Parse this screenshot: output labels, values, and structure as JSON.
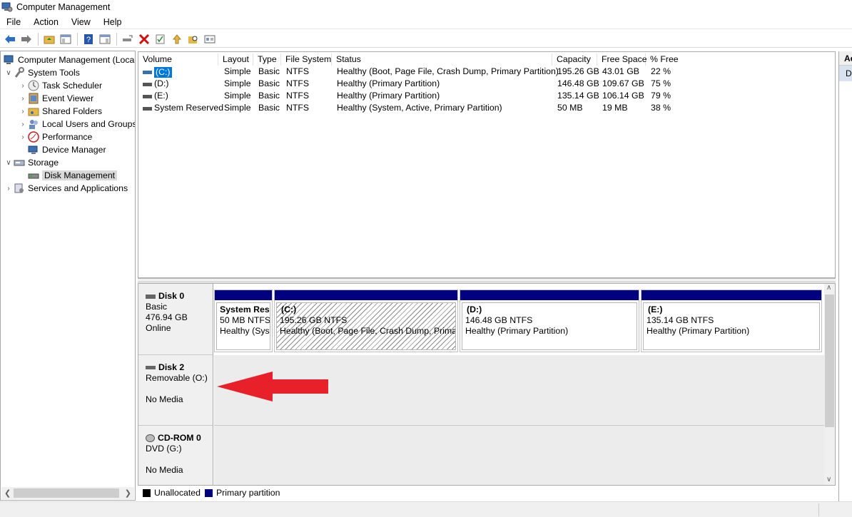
{
  "window": {
    "title": "Computer Management"
  },
  "menu": [
    "File",
    "Action",
    "View",
    "Help"
  ],
  "tree": {
    "root": "Computer Management (Local",
    "system_tools": "System Tools",
    "task_scheduler": "Task Scheduler",
    "event_viewer": "Event Viewer",
    "shared_folders": "Shared Folders",
    "local_users": "Local Users and Groups",
    "performance": "Performance",
    "device_manager": "Device Manager",
    "storage": "Storage",
    "disk_management": "Disk Management",
    "services": "Services and Applications"
  },
  "volumes": {
    "columns": [
      "Volume",
      "Layout",
      "Type",
      "File System",
      "Status",
      "Capacity",
      "Free Space",
      "% Free"
    ],
    "rows": [
      [
        "(C:)",
        "Simple",
        "Basic",
        "NTFS",
        "Healthy (Boot, Page File, Crash Dump, Primary Partition)",
        "195.26 GB",
        "43.01 GB",
        "22 %"
      ],
      [
        "(D:)",
        "Simple",
        "Basic",
        "NTFS",
        "Healthy (Primary Partition)",
        "146.48 GB",
        "109.67 GB",
        "75 %"
      ],
      [
        "(E:)",
        "Simple",
        "Basic",
        "NTFS",
        "Healthy (Primary Partition)",
        "135.14 GB",
        "106.14 GB",
        "79 %"
      ],
      [
        "System Reserved",
        "Simple",
        "Basic",
        "NTFS",
        "Healthy (System, Active, Primary Partition)",
        "50 MB",
        "19 MB",
        "38 %"
      ]
    ]
  },
  "disks": {
    "disk0": {
      "name": "Disk 0",
      "type": "Basic",
      "size": "476.94 GB",
      "state": "Online"
    },
    "disk2": {
      "name": "Disk 2",
      "type": "Removable (O:)",
      "state": "No Media"
    },
    "cdrom0": {
      "name": "CD-ROM 0",
      "type": "DVD (G:)",
      "state": "No Media"
    },
    "partitions": [
      {
        "name": "System Rese",
        "size": "50 MB NTFS",
        "status": "Healthy (Syst"
      },
      {
        "name": "(C:)",
        "size": "195.26 GB NTFS",
        "status": "Healthy (Boot, Page File, Crash Dump, Primary"
      },
      {
        "name": "(D:)",
        "size": "146.48 GB NTFS",
        "status": "Healthy (Primary Partition)"
      },
      {
        "name": "(E:)",
        "size": "135.14 GB NTFS",
        "status": "Healthy (Primary Partition)"
      }
    ]
  },
  "legend": {
    "unallocated": "Unallocated",
    "primary": "Primary partition"
  },
  "actions": {
    "header": "Ac",
    "item": "D"
  },
  "colors": {
    "primary_partition": "#000080",
    "unallocated": "#000000",
    "arrow": "#e8202a",
    "selection": "#d9d9d9"
  }
}
